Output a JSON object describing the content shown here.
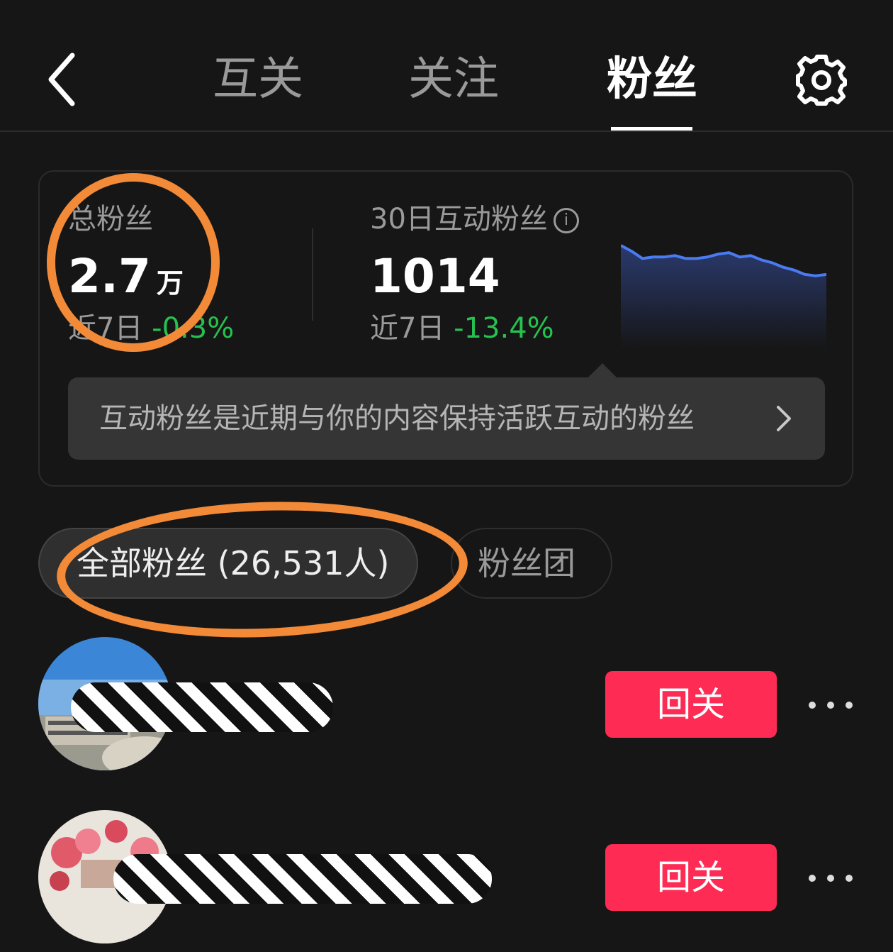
{
  "header": {
    "back_icon": "chevron-left-icon",
    "tabs": [
      {
        "label": "互关",
        "active": false
      },
      {
        "label": "关注",
        "active": false
      },
      {
        "label": "粉丝",
        "active": true
      }
    ],
    "settings_icon": "gear-icon"
  },
  "stats": {
    "total_fans": {
      "label": "总粉丝",
      "value": "2.7",
      "unit": "万",
      "change_prefix": "近7日",
      "change": "-0.3%"
    },
    "active_fans": {
      "label": "30日互动粉丝",
      "info_icon": "info-icon",
      "value": "1014",
      "change_prefix": "近7日",
      "change": "-13.4%"
    },
    "tip": {
      "text": "互动粉丝是近期与你的内容保持活跃互动的粉丝",
      "chevron_icon": "chevron-right-icon"
    }
  },
  "chart_data": {
    "type": "area",
    "trend": [
      100,
      96,
      91,
      92,
      92,
      93,
      91,
      91,
      92,
      94,
      95,
      92,
      93,
      90,
      88,
      85,
      83,
      80,
      79,
      80
    ],
    "color": "#4a7bf2"
  },
  "filters": [
    {
      "label": "全部粉丝 (26,531人)",
      "active": true
    },
    {
      "label": "粉丝团",
      "active": false
    }
  ],
  "followers": [
    {
      "follow_label": "回关",
      "more_icon": "more-dots-icon"
    },
    {
      "follow_label": "回关",
      "more_icon": "more-dots-icon"
    }
  ],
  "colors": {
    "accent_red": "#fe2c55",
    "green": "#26c24f",
    "annotation_orange": "#f28a38",
    "background": "#161616"
  }
}
